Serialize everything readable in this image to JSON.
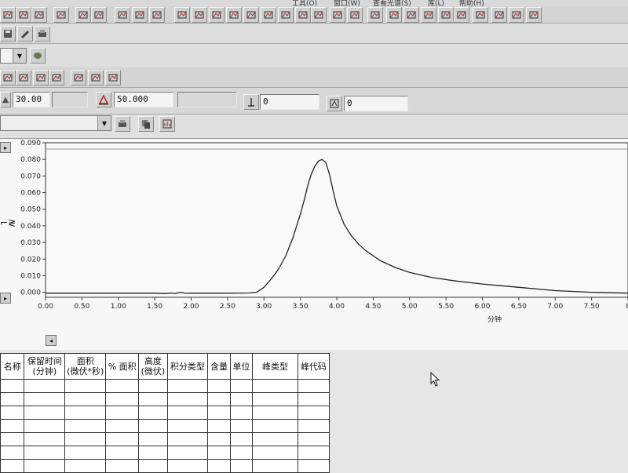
{
  "menu": {
    "items": [
      "工具(O)",
      "窗口(W)",
      "查看光谱(S)",
      "库(L)",
      "帮助(H)"
    ]
  },
  "params": {
    "field1_value": "30.00",
    "field2_value": "50.000",
    "field3_value": "0",
    "field4_value": "0"
  },
  "chart_data": {
    "type": "line",
    "xlabel": "分钟",
    "ylabel": "",
    "xlim": [
      0,
      8
    ],
    "ylim": [
      -0.003,
      0.09
    ],
    "x_ticks": [
      "0.00",
      "0.50",
      "1.00",
      "1.50",
      "2.00",
      "2.50",
      "3.00",
      "3.50",
      "4.00",
      "4.50",
      "5.00",
      "5.50",
      "6.00",
      "6.50",
      "7.00",
      "7.50",
      "8"
    ],
    "y_ticks": [
      "0.000",
      "0.010",
      "0.020",
      "0.030",
      "0.040",
      "0.050",
      "0.060",
      "0.070",
      "0.080",
      "0.090"
    ],
    "series": [
      {
        "x": [
          0.0,
          0.5,
          1.0,
          1.5,
          1.65,
          1.72,
          1.78,
          1.85,
          1.92,
          2.0,
          2.5,
          2.8,
          2.9,
          3.0,
          3.1,
          3.2,
          3.3,
          3.4,
          3.5,
          3.55,
          3.6,
          3.65,
          3.7,
          3.75,
          3.8,
          3.85,
          3.9,
          3.95,
          4.0,
          4.1,
          4.2,
          4.3,
          4.4,
          4.5,
          4.6,
          4.8,
          5.0,
          5.3,
          5.6,
          6.0,
          6.5,
          7.0,
          7.5,
          8.0
        ],
        "y": [
          -0.0005,
          -0.0005,
          -0.0005,
          -0.0005,
          -0.0008,
          -0.0004,
          -0.0007,
          0.0,
          -0.0006,
          -0.0005,
          -0.0005,
          -0.0004,
          0.0,
          0.003,
          0.008,
          0.014,
          0.022,
          0.033,
          0.047,
          0.055,
          0.064,
          0.071,
          0.076,
          0.079,
          0.08,
          0.078,
          0.071,
          0.061,
          0.052,
          0.041,
          0.034,
          0.029,
          0.025,
          0.022,
          0.019,
          0.015,
          0.012,
          0.009,
          0.007,
          0.005,
          0.003,
          0.001,
          0.0,
          -0.0005
        ]
      }
    ]
  },
  "table": {
    "headers": [
      {
        "line1": "名称",
        "line2": ""
      },
      {
        "line1": "保留时间",
        "line2": "(分钟)"
      },
      {
        "line1": "面积",
        "line2": "(微伏*秒)"
      },
      {
        "line1": "% 面积",
        "line2": ""
      },
      {
        "line1": "高度",
        "line2": "(微伏)"
      },
      {
        "line1": "积分类型",
        "line2": ""
      },
      {
        "line1": "含量",
        "line2": ""
      },
      {
        "line1": "单位",
        "line2": ""
      },
      {
        "line1": "峰类型",
        "line2": ""
      },
      {
        "line1": "峰代码",
        "line2": ""
      }
    ]
  }
}
